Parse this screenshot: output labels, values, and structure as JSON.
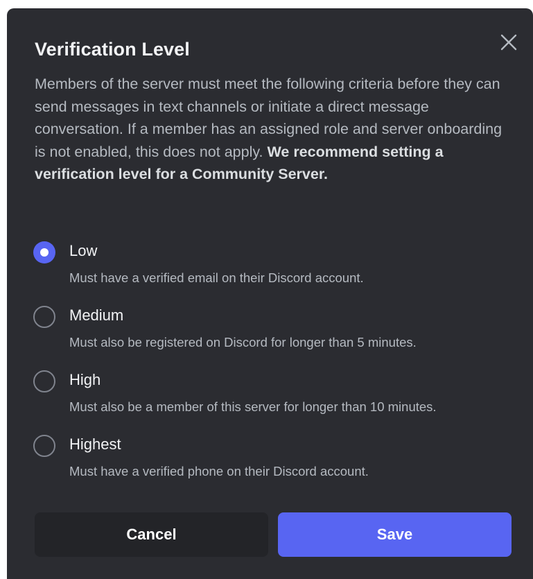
{
  "dialog": {
    "title": "Verification Level",
    "description": "Members of the server must meet the following criteria before they can send messages in text channels or initiate a direct message conversation. If a member has an assigned role and server onboarding is not enabled, this does not apply.",
    "description_bold": "We recommend setting a verification level for a Community Server.",
    "close_icon": "close-icon"
  },
  "options": [
    {
      "label": "Low",
      "description": "Must have a verified email on their Discord account.",
      "selected": true
    },
    {
      "label": "Medium",
      "description": "Must also be registered on Discord for longer than 5 minutes.",
      "selected": false
    },
    {
      "label": "High",
      "description": "Must also be a member of this server for longer than 10 minutes.",
      "selected": false
    },
    {
      "label": "Highest",
      "description": "Must have a verified phone on their Discord account.",
      "selected": false
    }
  ],
  "buttons": {
    "cancel_label": "Cancel",
    "save_label": "Save"
  },
  "colors": {
    "background": "#2b2c31",
    "accent": "#5865f2",
    "secondary_button": "#232428",
    "heading_text": "#f2f3f5",
    "body_text": "#b5bac1"
  }
}
